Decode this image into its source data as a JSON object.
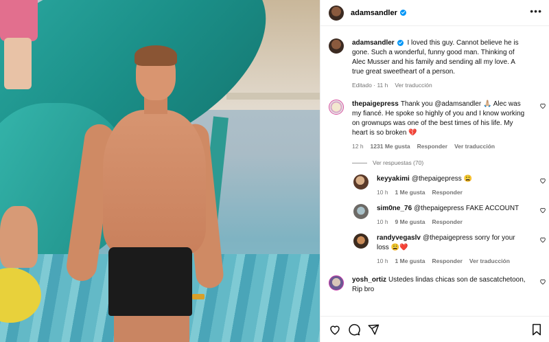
{
  "post": {
    "author": "adamsandler",
    "verified": true
  },
  "caption": {
    "user": "adamsandler",
    "text": " I loved this guy. Cannot believe he is gone. Such a wonderful, funny good man. Thinking of Alec Musser and his family and sending all my love. A true great sweetheart of a person.",
    "edited": "Editado",
    "dot": "·",
    "time": "11 h",
    "see_translation": "Ver traducción"
  },
  "comments": [
    {
      "user": "thepaigepress",
      "text": "Thank you @adamsandler 🙏🏼 Alec was my fiancé. He spoke so highly of you and I know working on grownups was one of the best times of his life. My heart is so broken 💔",
      "time": "12 h",
      "likes": "1231 Me gusta",
      "reply": "Responder",
      "see_translation": "Ver traducción",
      "view_replies": "Ver respuestas (70)",
      "replies": [
        {
          "user": "keyyakimi",
          "text": "@thepaigepress 😩",
          "time": "10 h",
          "likes": "1 Me gusta",
          "reply": "Responder"
        },
        {
          "user": "sim0ne_76",
          "text": "@thepaigepress FAKE ACCOUNT",
          "time": "10 h",
          "likes": "9 Me gusta",
          "reply": "Responder"
        },
        {
          "user": "randyvegaslv",
          "text": "@thepaigepress sorry for your loss 😩❤️",
          "time": "10 h",
          "likes": "1 Me gusta",
          "reply": "Responder",
          "see_translation": "Ver traducción"
        }
      ]
    },
    {
      "user": "yosh_ortiz",
      "text": "Ustedes lindas chicas son de sascatchetoon, Rip bro"
    }
  ],
  "icons": {
    "more": "more-icon",
    "like": "heart-icon",
    "comment": "comment-icon",
    "share": "share-icon",
    "save": "bookmark-icon"
  },
  "colors": {
    "verified": "#0095f6",
    "meta_text": "#737373",
    "story_ring": "#d94f9f"
  }
}
